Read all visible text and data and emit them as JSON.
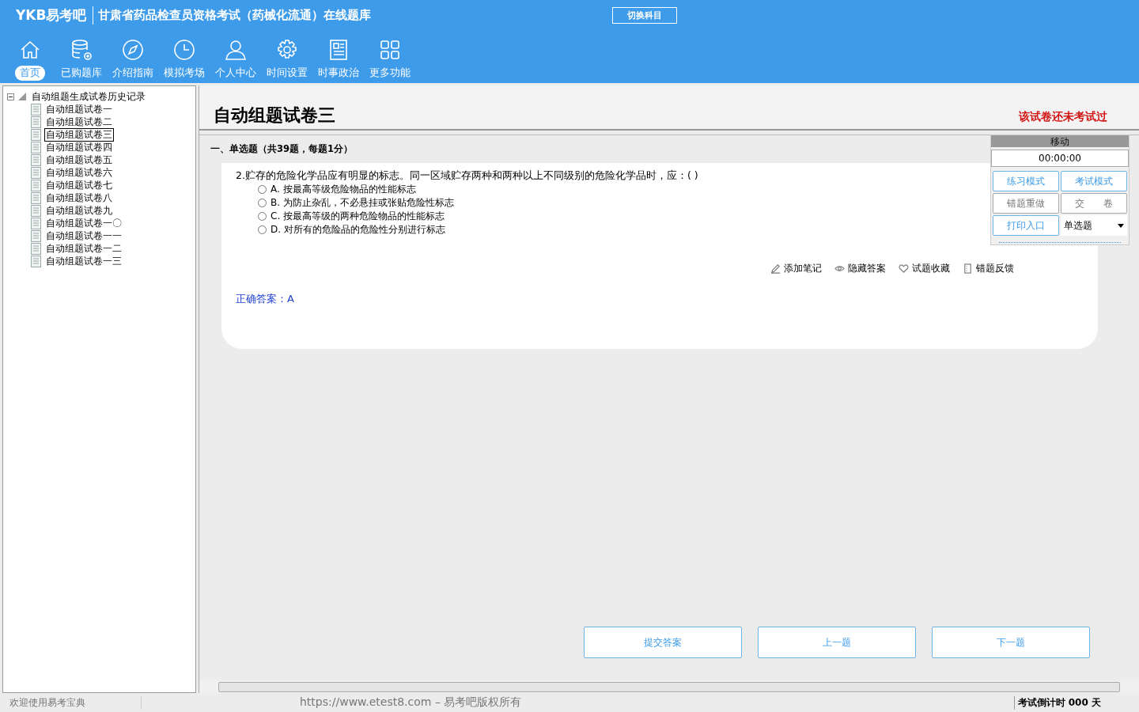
{
  "header": {
    "logo": "YKB易考吧",
    "title": "甘肃省药品检查员资格考试（药械化流通）在线题库",
    "switch_button": "切换科目"
  },
  "nav": [
    {
      "label": "首页",
      "kind": "home",
      "selected": true
    },
    {
      "label": "已购题库",
      "kind": "database",
      "selected": false
    },
    {
      "label": "介绍指南",
      "kind": "compass",
      "selected": false
    },
    {
      "label": "模拟考场",
      "kind": "clock",
      "selected": false
    },
    {
      "label": "个人中心",
      "kind": "user",
      "selected": false
    },
    {
      "label": "时间设置",
      "kind": "gear",
      "selected": false
    },
    {
      "label": "时事政治",
      "kind": "news",
      "selected": false
    },
    {
      "label": "更多功能",
      "kind": "grid",
      "selected": false
    }
  ],
  "tree": {
    "label": "自动组题生成试卷历史记录",
    "expanded": true,
    "children": [
      {
        "label": "自动组题试卷一",
        "selected": false
      },
      {
        "label": "自动组题试卷二",
        "selected": false
      },
      {
        "label": "自动组题试卷三",
        "selected": true
      },
      {
        "label": "自动组题试卷四",
        "selected": false
      },
      {
        "label": "自动组题试卷五",
        "selected": false
      },
      {
        "label": "自动组题试卷六",
        "selected": false
      },
      {
        "label": "自动组题试卷七",
        "selected": false
      },
      {
        "label": "自动组题试卷八",
        "selected": false
      },
      {
        "label": "自动组题试卷九",
        "selected": false
      },
      {
        "label": "自动组题试卷一〇",
        "selected": false
      },
      {
        "label": "自动组题试卷一一",
        "selected": false
      },
      {
        "label": "自动组题试卷一二",
        "selected": false
      },
      {
        "label": "自动组题试卷一三",
        "selected": false
      }
    ]
  },
  "paper": {
    "title": "自动组题试卷三",
    "status": "该试卷还未考试过"
  },
  "section": "一、单选题（共39题，每题1分）",
  "question": {
    "text": "2.贮存的危险化学品应有明显的标志。同一区域贮存两种和两种以上不同级别的危险化学品时，应：( )",
    "options": [
      {
        "label": "A. 按最高等级危险物品的性能标志",
        "checked": false
      },
      {
        "label": "B. 为防止杂乱，不必悬挂或张贴危险性标志",
        "checked": false
      },
      {
        "label": "C. 按最高等级的两种危险物品的性能标志",
        "checked": false
      },
      {
        "label": "D. 对所有的危险品的危险性分别进行标志",
        "checked": false
      }
    ],
    "actions": [
      {
        "label": "添加笔记",
        "kind": "pencil"
      },
      {
        "label": "隐藏答案",
        "kind": "eye"
      },
      {
        "label": "试题收藏",
        "kind": "heart"
      },
      {
        "label": "错题反馈",
        "kind": "book"
      }
    ],
    "answer": "正确答案：A"
  },
  "panel": {
    "title": "移动",
    "timer": "00:00:00",
    "buttons": [
      {
        "label": "练习模式",
        "kind": "blue"
      },
      {
        "label": "考试模式",
        "kind": "blue"
      },
      {
        "label": "错题重做",
        "kind": "grey"
      },
      {
        "label": "交　　卷",
        "kind": "grey"
      },
      {
        "label": "打印入口",
        "kind": "blue"
      }
    ],
    "select": "单选题"
  },
  "bottom_buttons": [
    "提交答案",
    "上一题",
    "下一题"
  ],
  "status_bar": {
    "welcome": "欢迎使用易考宝典",
    "copyright": "https://www.etest8.com – 易考吧版权所有",
    "countdown": "考试倒计时 000 天"
  }
}
